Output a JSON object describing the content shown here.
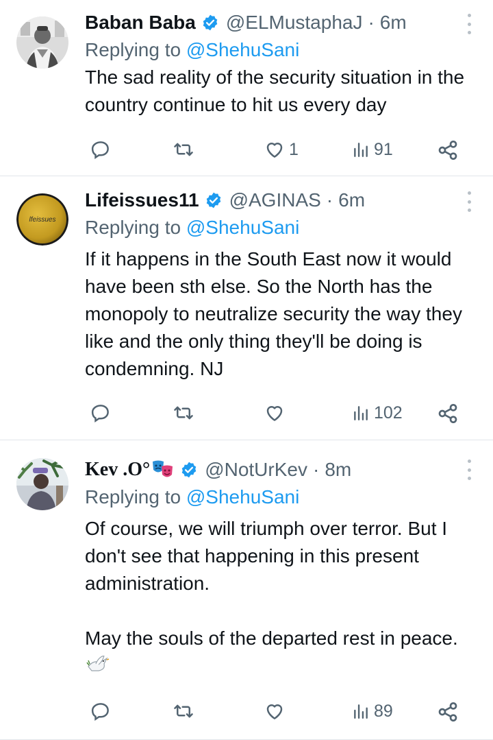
{
  "tweets": [
    {
      "name": "Baban Baba",
      "handle": "@ELMustaphaJ",
      "time": "6m",
      "replying_prefix": "Replying to",
      "replying_to": "@ShehuSani",
      "body": [
        "The sad reality of the security situation in the country continue to hit us every day"
      ],
      "likes": "1",
      "views": "91",
      "avatar_icon": "person-portrait-grayscale"
    },
    {
      "name": "Lifeissues11",
      "handle": "@AGINAS",
      "time": "6m",
      "replying_prefix": "Replying to",
      "replying_to": "@ShehuSani",
      "body": [
        "If it happens in the South East now it would have been sth else. So the North has the monopoly to neutralize security the way they like and the only thing they'll be doing is condemning. NJ"
      ],
      "likes": "",
      "views": "102",
      "avatar_text": "lfeissues",
      "avatar_color": "#c9a227"
    },
    {
      "name": "Kev .O°",
      "name_emoji": "performing-arts-masks",
      "handle": "@NotUrKev",
      "time": "8m",
      "replying_prefix": "Replying to",
      "replying_to": "@ShehuSani",
      "body": [
        "Of course, we will triumph over terror. But I don't see that happening in this present administration.",
        "",
        "May the souls of the departed rest in peace."
      ],
      "body_trailing_emoji": "dove-icon",
      "likes": "",
      "views": "89",
      "avatar_icon": "person-palm-tree-photo"
    }
  ],
  "colors": {
    "text": "#0f1419",
    "secondary": "#536471",
    "link": "#1d9bf0",
    "verified": "#1d9bf0",
    "divider": "#e1e6ea"
  },
  "icons": {
    "reply": "speech-bubble-icon",
    "retweet": "retweet-arrows-icon",
    "like": "heart-icon",
    "views": "bar-chart-icon",
    "share": "share-nodes-icon",
    "more": "vertical-dots-icon",
    "verified": "verified-badge-icon"
  }
}
